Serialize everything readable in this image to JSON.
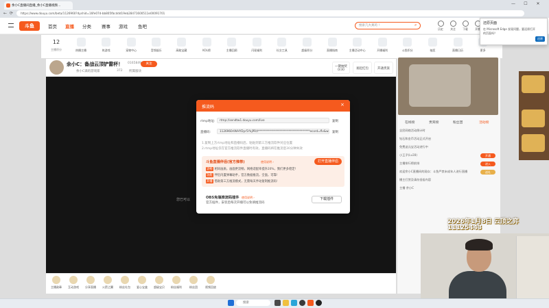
{
  "browser": {
    "tab_title": "余小C直播间直播_余小C直播视频...",
    "address": "https://www.douyu.com/beta/1126960?dyshid=16fe07d-bb805fbcddd19eb28471600511e00091701",
    "win_minimize": "—",
    "win_maximize": "☐",
    "win_close": "✕",
    "back": "←",
    "refresh": "⟳"
  },
  "header": {
    "logo": "斗鱼",
    "nav": [
      "首页",
      "直播",
      "分类",
      "赛事",
      "游戏",
      "鱼吧"
    ],
    "search_placeholder": "搜索几大真的 !",
    "tools": [
      "历史",
      "关注",
      "下载",
      "开播"
    ]
  },
  "category_bar": {
    "rank_number": "12",
    "rank_label": "主播积分",
    "items": [
      "热播主播",
      "热游戏",
      "宠物中心",
      "音频娱乐",
      "高能宝藏",
      "KOL榜",
      "主播回顾",
      "闪现福利",
      "社交工具",
      "超级积分",
      "直播指南",
      "主播活动中心",
      "开播福利",
      "斗鱼积分",
      "抽奖",
      "直播日历",
      "更多"
    ]
  },
  "room": {
    "title": "余小C：备战云顶铲雷杯！",
    "uid": "0165849",
    "follow_label": "关注",
    "streamer_name": "余小C满的游戏家",
    "fans": "372",
    "category": "所属版块",
    "badge_count": "0/30",
    "box_label": "一键抽奖",
    "gift_label": "发起红包",
    "vip_label": "开通贵族"
  },
  "player": {
    "status_text": "您已可以 "
  },
  "gifts": [
    "主播勋章",
    "互动游戏",
    "分享直播",
    "火箭之翼",
    "粉丝礼包",
    "爱心宝盒",
    "超级宝贝",
    "粉丝福利",
    "粉丝团",
    "视频回放"
  ],
  "right_panel": {
    "tabs": [
      "在线榜",
      "贵宾榜",
      "粉丝团",
      "活动榜"
    ],
    "lines": [
      "全民网络活动倒计时",
      "钻石和金币活动正式开启",
      "免费送元宝活动进行中",
      "小王子(Lv28)",
      "主播排行榜前排",
      "欢迎余小C直播间的观众：斗鱼严禁未成年人进行直播",
      "播主打赏及请勿低俗内容",
      "主播 余小C"
    ],
    "buttons": [
      "开通",
      "进入",
      "送礼"
    ]
  },
  "notification": {
    "title": "还原页面",
    "text": "在 Microsoft Edge 发现问题，要还原打开的页面吗？",
    "button": "还原"
  },
  "overlay": {
    "line1": "2026年1月8日 云顶之弈",
    "line2": "11125443"
  },
  "modal": {
    "title": "推流码",
    "close": "×",
    "fields": [
      {
        "label": "rtmp地址:",
        "value": "rtmp://sendtw1.douyu.com/live",
        "copy": "复制"
      },
      {
        "label": "直播码:",
        "value": "1126960rlWHYDyr5YkjPR/t************************************ecord=flv&wsSecret",
        "copy": "复制"
      }
    ],
    "tips": [
      "1.复制上方rtmp地址和直播码后，粘贴到第三方推流软件对应位置",
      "2.rtmp地址仅在官方推流软件直播时有效，直播码将在推流后30分钟失效"
    ],
    "promo": {
      "title": "斗鱼直播伴侣(官方推荐)",
      "link": "使用说明 ›",
      "button": "打开直播伴侣",
      "rows": [
        {
          "tag": "流畅",
          "text": "相同画质，画面更流畅，网络适配率提升20%，我们更多稳定!"
        },
        {
          "tag": "功能",
          "text": "伴侣内置弹幕助手，官方数据推流，全面，可靠!"
        },
        {
          "tag": "开播",
          "text": "借助第三方推流模式，无需每天手动复制推流码!"
        }
      ]
    },
    "obs": {
      "title": "OBS免填推流码插件",
      "link": "使用说明 ›",
      "desc": "官方插件，安装后每次开播可以免填推流码",
      "button": "下载插件"
    }
  },
  "taskbar": {
    "search": "搜索"
  },
  "colors": {
    "accent": "#f55a1e",
    "promo_bg": "#fdeee6",
    "player_bg": "#141414"
  }
}
